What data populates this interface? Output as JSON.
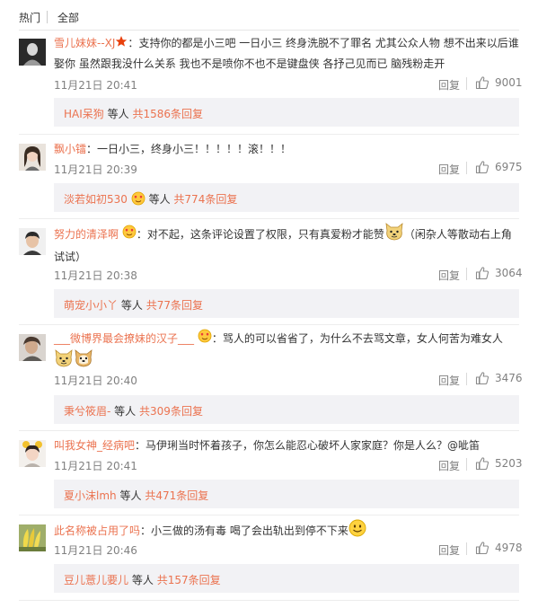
{
  "tabs": {
    "hot": "热门",
    "all": "全部"
  },
  "labels": {
    "reply": "回复",
    "people": "等人",
    "total_prefix": "共",
    "total_suffix": "条回复"
  },
  "comments": [
    {
      "name": "雪儿妹妹--XJ",
      "colon": "：",
      "text": "支持你的都是小三吧 一日小三 终身洗脱不了罪名 尤其公众人物 想不出来以后谁娶你 虽然跟我没什么关系 我也不是喷你不也不是键盘侠 各抒己见而已 脑残粉走开",
      "time": "11月21日 20:41",
      "likes": "9001",
      "sub_name": "HAI呆狗",
      "sub_count": "1586"
    },
    {
      "name": "飘小镭",
      "colon": "：",
      "text": "一日小三，终身小三！！！！！滚！！！",
      "time": "11月21日 20:39",
      "likes": "6975",
      "sub_name": "淡若如初530",
      "sub_count": "774"
    },
    {
      "name": "努力的清泽啊",
      "colon": "：",
      "text": "对不起，这条评论设置了权限，只有真爱粉才能赞",
      "text2": "（闲杂人等散动右上角试试）",
      "time": "11月21日 20:38",
      "likes": "3064",
      "sub_name": "萌宠小小丫",
      "sub_count": "77"
    },
    {
      "name": "___微博界最会撩妹的汉子___",
      "colon": "：",
      "text": "骂人的可以省省了，为什么不去骂文章，女人何苦为难女人",
      "time": "11月21日 20:40",
      "likes": "3476",
      "sub_name": "秉兮筱眉-",
      "sub_count": "309"
    },
    {
      "name": "叫我女神_经病吧",
      "colon": "：",
      "text": "马伊琍当时怀着孩子，你怎么能忍心破坏人家家庭？你是人么？@呲笛",
      "time": "11月21日 20:41",
      "likes": "5203",
      "sub_name": "夏小沫lmh",
      "sub_count": "471"
    },
    {
      "name": "此名称被占用了吗",
      "colon": "：",
      "text": "小三做的汤有毒 喝了会出轨出到停不下来",
      "time": "11月21日 20:46",
      "likes": "4978",
      "sub_name": "豆儿薏儿要儿",
      "sub_count": "157"
    }
  ]
}
